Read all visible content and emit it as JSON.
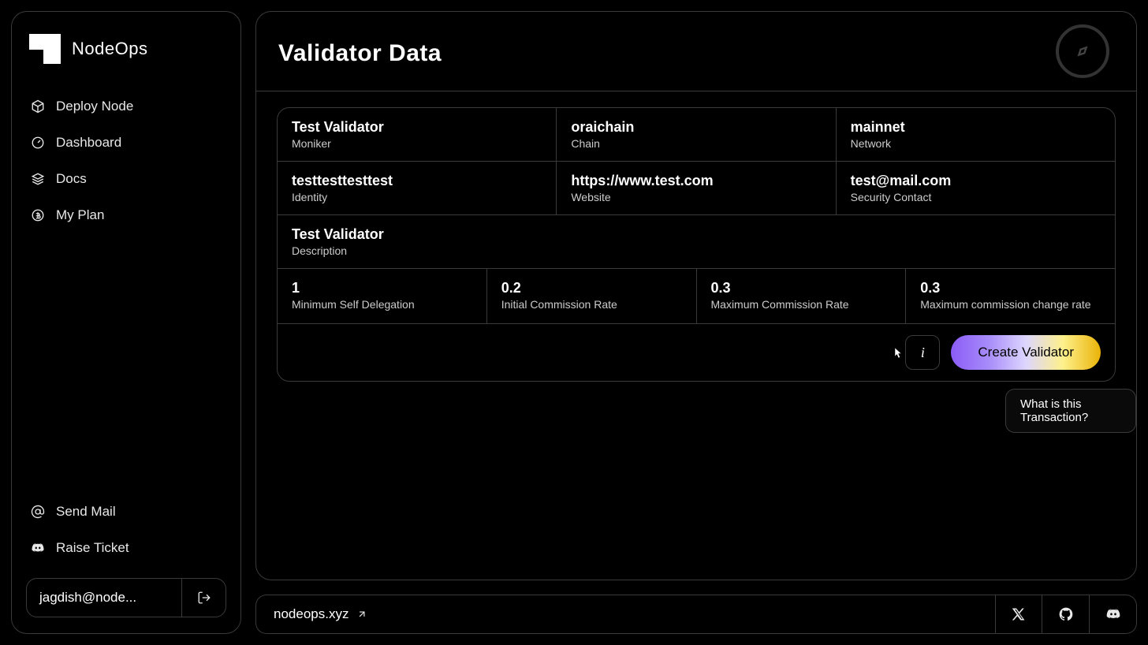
{
  "brand": "NodeOps",
  "sidebar": {
    "items": [
      {
        "label": "Deploy Node",
        "icon": "cube-icon"
      },
      {
        "label": "Dashboard",
        "icon": "gauge-icon"
      },
      {
        "label": "Docs",
        "icon": "layers-icon"
      },
      {
        "label": "My Plan",
        "icon": "coin-icon"
      }
    ],
    "bottom": [
      {
        "label": "Send Mail",
        "icon": "at-icon"
      },
      {
        "label": "Raise Ticket",
        "icon": "discord-icon"
      }
    ],
    "user_email": "jagdish@node..."
  },
  "page": {
    "title": "Validator Data"
  },
  "validator": {
    "moniker": {
      "value": "Test Validator",
      "label": "Moniker"
    },
    "chain": {
      "value": "oraichain",
      "label": "Chain"
    },
    "network": {
      "value": "mainnet",
      "label": "Network"
    },
    "identity": {
      "value": "testtesttesttest",
      "label": "Identity"
    },
    "website": {
      "value": "https://www.test.com",
      "label": "Website"
    },
    "security_contact": {
      "value": "test@mail.com",
      "label": "Security Contact"
    },
    "description": {
      "value": "Test Validator",
      "label": "Description"
    },
    "min_self_delegation": {
      "value": "1",
      "label": "Minimum Self Delegation"
    },
    "initial_commission": {
      "value": "0.2",
      "label": "Initial Commission Rate"
    },
    "max_commission": {
      "value": "0.3",
      "label": "Maximum Commission Rate"
    },
    "max_commission_change": {
      "value": "0.3",
      "label": "Maximum commission change rate"
    }
  },
  "actions": {
    "create_label": "Create Validator",
    "tooltip": "What is this Transaction?"
  },
  "footer": {
    "url": "nodeops.xyz"
  }
}
